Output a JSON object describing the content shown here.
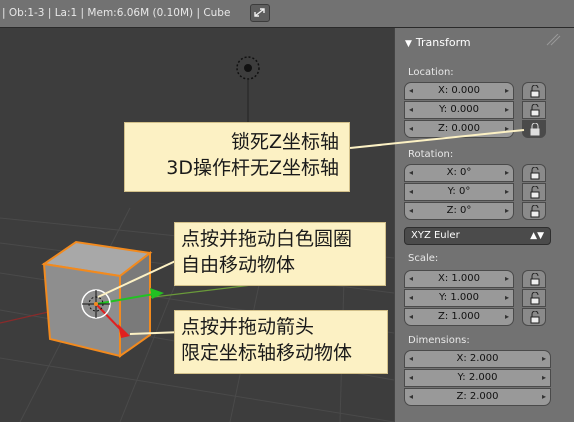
{
  "header": {
    "info": "| Ob:1-3 | La:1 | Mem:6.06M (0.10M) | Cube"
  },
  "panel": {
    "title": "Transform",
    "location": {
      "label": "Location:",
      "x": "X: 0.000",
      "y": "Y: 0.000",
      "z": "Z: 0.000"
    },
    "rotation": {
      "label": "Rotation:",
      "x": "X: 0°",
      "y": "Y: 0°",
      "z": "Z: 0°"
    },
    "rotation_mode": "XYZ Euler",
    "scale": {
      "label": "Scale:",
      "x": "X: 1.000",
      "y": "Y: 1.000",
      "z": "Z: 1.000"
    },
    "dimensions": {
      "label": "Dimensions:",
      "x": "X: 2.000",
      "y": "Y: 2.000",
      "z": "Z: 2.000"
    },
    "locks": {
      "location_z_locked": true
    }
  },
  "callouts": {
    "lock_z": {
      "line1": "锁死Z坐标轴",
      "line2": "3D操作杆无Z坐标轴"
    },
    "drag_circle": {
      "line1": "点按并拖动白色圆圈",
      "line2": "自由移动物体"
    },
    "drag_arrow": {
      "line1": "点按并拖动箭头",
      "line2": "限定坐标轴移动物体"
    }
  },
  "colors": {
    "viewport_bg": "#3d3d3d",
    "panel_bg": "#727272",
    "callout_bg": "#fcf1c4",
    "selection_orange": "#f28a1e",
    "x_axis_red": "#e02020",
    "y_axis_green": "#22c222"
  }
}
